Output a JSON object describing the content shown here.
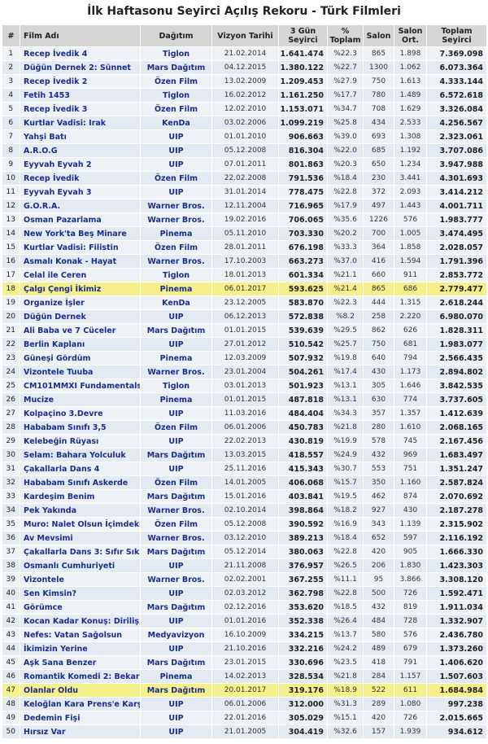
{
  "title": "İlk Haftasonu Seyirci Açılış Rekoru - Türk Filmleri",
  "columns": {
    "rank": "#",
    "film": "Film Adı",
    "distributor": "Dağıtım",
    "release": "Vizyon Tarihi",
    "audience_l1": "3 Gün",
    "audience_l2": "Seyirci",
    "pct_l1": "%",
    "pct_l2": "Toplam",
    "salon": "Salon",
    "avg_l1": "Salon",
    "avg_l2": "Ort.",
    "total_l1": "Toplam",
    "total_l2": "Seyirci"
  },
  "highlight_color": "#f5ef8c",
  "rows": [
    {
      "rank": "1",
      "film": "Recep İvedik 4",
      "dist": "Tiglon",
      "date": "21.02.2014",
      "aud": "1.641.474",
      "pct": "%22.3",
      "salon": "865",
      "avg": "1.898",
      "total": "7.369.098"
    },
    {
      "rank": "2",
      "film": "Düğün Dernek 2: Sünnet",
      "dist": "Mars Dağıtım",
      "date": "04.12.2015",
      "aud": "1.380.122",
      "pct": "%22.7",
      "salon": "1300",
      "avg": "1.062",
      "total": "6.073.364"
    },
    {
      "rank": "3",
      "film": "Recep İvedik 2",
      "dist": "Özen Film",
      "date": "13.02.2009",
      "aud": "1.209.453",
      "pct": "%27.9",
      "salon": "750",
      "avg": "1.613",
      "total": "4.333.144"
    },
    {
      "rank": "4",
      "film": "Fetih 1453",
      "dist": "Tiglon",
      "date": "16.02.2012",
      "aud": "1.161.250",
      "pct": "%17.7",
      "salon": "780",
      "avg": "1.489",
      "total": "6.572.618"
    },
    {
      "rank": "5",
      "film": "Recep İvedik 3",
      "dist": "Özen Film",
      "date": "12.02.2010",
      "aud": "1.153.071",
      "pct": "%34.7",
      "salon": "708",
      "avg": "1.629",
      "total": "3.326.084"
    },
    {
      "rank": "6",
      "film": "Kurtlar Vadisi: Irak",
      "dist": "KenDa",
      "date": "03.02.2006",
      "aud": "1.099.219",
      "pct": "%25.8",
      "salon": "434",
      "avg": "2.533",
      "total": "4.256.567"
    },
    {
      "rank": "7",
      "film": "Yahşi Batı",
      "dist": "UIP",
      "date": "01.01.2010",
      "aud": "906.663",
      "pct": "%39.0",
      "salon": "693",
      "avg": "1.308",
      "total": "2.323.061"
    },
    {
      "rank": "8",
      "film": "A.R.O.G",
      "dist": "UIP",
      "date": "05.12.2008",
      "aud": "816.304",
      "pct": "%22.0",
      "salon": "685",
      "avg": "1.192",
      "total": "3.707.086"
    },
    {
      "rank": "9",
      "film": "Eyyvah Eyvah 2",
      "dist": "UIP",
      "date": "07.01.2011",
      "aud": "801.863",
      "pct": "%20.3",
      "salon": "650",
      "avg": "1.234",
      "total": "3.947.988"
    },
    {
      "rank": "10",
      "film": "Recep İvedik",
      "dist": "Özen Film",
      "date": "22.02.2008",
      "aud": "791.536",
      "pct": "%18.4",
      "salon": "230",
      "avg": "3.441",
      "total": "4.301.693"
    },
    {
      "rank": "11",
      "film": "Eyyvah Eyvah 3",
      "dist": "UIP",
      "date": "31.01.2014",
      "aud": "778.475",
      "pct": "%22.8",
      "salon": "372",
      "avg": "2.093",
      "total": "3.414.212"
    },
    {
      "rank": "12",
      "film": "G.O.R.A.",
      "dist": "Warner Bros.",
      "date": "12.11.2004",
      "aud": "716.965",
      "pct": "%17.9",
      "salon": "497",
      "avg": "1.443",
      "total": "4.001.711"
    },
    {
      "rank": "13",
      "film": "Osman Pazarlama",
      "dist": "Warner Bros.",
      "date": "19.02.2016",
      "aud": "706.065",
      "pct": "%35.6",
      "salon": "1226",
      "avg": "576",
      "total": "1.983.777"
    },
    {
      "rank": "14",
      "film": "New York'ta Beş Minare",
      "dist": "Pinema",
      "date": "05.11.2010",
      "aud": "703.330",
      "pct": "%20.2",
      "salon": "700",
      "avg": "1.005",
      "total": "3.474.495"
    },
    {
      "rank": "15",
      "film": "Kurtlar Vadisi: Filistin",
      "dist": "Özen Film",
      "date": "28.01.2011",
      "aud": "676.198",
      "pct": "%33.3",
      "salon": "364",
      "avg": "1.858",
      "total": "2.028.057"
    },
    {
      "rank": "16",
      "film": "Asmalı Konak - Hayat",
      "dist": "Warner Bros.",
      "date": "17.10.2003",
      "aud": "663.273",
      "pct": "%37.0",
      "salon": "416",
      "avg": "1.594",
      "total": "1.791.396"
    },
    {
      "rank": "17",
      "film": "Celal ile Ceren",
      "dist": "Tiglon",
      "date": "18.01.2013",
      "aud": "601.334",
      "pct": "%21.1",
      "salon": "660",
      "avg": "911",
      "total": "2.853.772"
    },
    {
      "rank": "18",
      "film": "Çalgı Çengi İkimiz",
      "dist": "Pinema",
      "date": "06.01.2017",
      "aud": "593.625",
      "pct": "%21.4",
      "salon": "865",
      "avg": "686",
      "total": "2.779.477",
      "hl": true
    },
    {
      "rank": "19",
      "film": "Organize İşler",
      "dist": "KenDa",
      "date": "23.12.2005",
      "aud": "583.870",
      "pct": "%22.3",
      "salon": "444",
      "avg": "1.315",
      "total": "2.618.244"
    },
    {
      "rank": "20",
      "film": "Düğün Dernek",
      "dist": "UIP",
      "date": "06.12.2013",
      "aud": "572.838",
      "pct": "%8.2",
      "salon": "258",
      "avg": "2.220",
      "total": "6.980.070"
    },
    {
      "rank": "21",
      "film": "Ali Baba ve 7 Cüceler",
      "dist": "Mars Dağıtım",
      "date": "01.01.2015",
      "aud": "539.639",
      "pct": "%29.5",
      "salon": "862",
      "avg": "626",
      "total": "1.828.311"
    },
    {
      "rank": "22",
      "film": "Berlin Kaplanı",
      "dist": "UIP",
      "date": "27.01.2012",
      "aud": "510.542",
      "pct": "%25.7",
      "salon": "750",
      "avg": "681",
      "total": "1.983.077"
    },
    {
      "rank": "23",
      "film": "Güneşi Gördüm",
      "dist": "Pinema",
      "date": "12.03.2009",
      "aud": "507.932",
      "pct": "%19.8",
      "salon": "640",
      "avg": "794",
      "total": "2.566.435"
    },
    {
      "rank": "24",
      "film": "Vizontele Tuuba",
      "dist": "Warner Bros.",
      "date": "23.01.2004",
      "aud": "504.261",
      "pct": "%17.4",
      "salon": "430",
      "avg": "1.173",
      "total": "2.894.802"
    },
    {
      "rank": "25",
      "film": "CM101MMXI Fundamentals",
      "dist": "Tiglon",
      "date": "03.01.2013",
      "aud": "501.923",
      "pct": "%13.1",
      "salon": "305",
      "avg": "1.646",
      "total": "3.842.535"
    },
    {
      "rank": "26",
      "film": "Mucize",
      "dist": "Pinema",
      "date": "01.01.2015",
      "aud": "487.818",
      "pct": "%13.1",
      "salon": "630",
      "avg": "774",
      "total": "3.737.605"
    },
    {
      "rank": "27",
      "film": "Kolpaçino 3.Devre",
      "dist": "UIP",
      "date": "11.03.2016",
      "aud": "484.404",
      "pct": "%34.3",
      "salon": "357",
      "avg": "1.357",
      "total": "1.412.639"
    },
    {
      "rank": "28",
      "film": "Hababam Sınıfı 3,5",
      "dist": "Özen Film",
      "date": "06.01.2006",
      "aud": "450.783",
      "pct": "%21.8",
      "salon": "280",
      "avg": "1.610",
      "total": "2.068.165"
    },
    {
      "rank": "29",
      "film": "Kelebeğin Rüyası",
      "dist": "UIP",
      "date": "22.02.2013",
      "aud": "430.819",
      "pct": "%19.9",
      "salon": "578",
      "avg": "745",
      "total": "2.167.456"
    },
    {
      "rank": "30",
      "film": "Selam: Bahara Yolculuk",
      "dist": "Mars Dağıtım",
      "date": "13.03.2015",
      "aud": "418.557",
      "pct": "%24.9",
      "salon": "432",
      "avg": "969",
      "total": "1.683.497"
    },
    {
      "rank": "31",
      "film": "Çakallarla Dans 4",
      "dist": "UIP",
      "date": "25.11.2016",
      "aud": "415.343",
      "pct": "%30.7",
      "salon": "553",
      "avg": "751",
      "total": "1.351.247"
    },
    {
      "rank": "32",
      "film": "Hababam Sınıfı Askerde",
      "dist": "Özen Film",
      "date": "14.01.2005",
      "aud": "406.068",
      "pct": "%15.7",
      "salon": "350",
      "avg": "1.160",
      "total": "2.587.824"
    },
    {
      "rank": "33",
      "film": "Kardeşim Benim",
      "dist": "Mars Dağıtım",
      "date": "15.01.2016",
      "aud": "403.841",
      "pct": "%19.5",
      "salon": "462",
      "avg": "874",
      "total": "2.070.692"
    },
    {
      "rank": "34",
      "film": "Pek Yakında",
      "dist": "Warner Bros.",
      "date": "02.10.2014",
      "aud": "398.864",
      "pct": "%18.2",
      "salon": "927",
      "avg": "430",
      "total": "2.187.278"
    },
    {
      "rank": "35",
      "film": "Muro: Nalet Olsun İçimdeki İnsan",
      "dist": "Özen Film",
      "date": "05.12.2008",
      "aud": "390.592",
      "pct": "%16.9",
      "salon": "343",
      "avg": "1.139",
      "total": "2.315.902"
    },
    {
      "rank": "36",
      "film": "Av Mevsimi",
      "dist": "Warner Bros.",
      "date": "03.12.2010",
      "aud": "389.213",
      "pct": "%18.4",
      "salon": "652",
      "avg": "597",
      "total": "2.116.192"
    },
    {
      "rank": "37",
      "film": "Çakallarla Dans 3: Sıfır Sıkıntı",
      "dist": "Mars Dağıtım",
      "date": "05.12.2014",
      "aud": "380.063",
      "pct": "%22.8",
      "salon": "420",
      "avg": "905",
      "total": "1.666.330"
    },
    {
      "rank": "38",
      "film": "Osmanlı Cumhuriyeti",
      "dist": "UIP",
      "date": "21.11.2008",
      "aud": "376.957",
      "pct": "%26.5",
      "salon": "206",
      "avg": "1.830",
      "total": "1.423.303"
    },
    {
      "rank": "39",
      "film": "Vizontele",
      "dist": "Warner Bros.",
      "date": "02.02.2001",
      "aud": "367.255",
      "pct": "%11.1",
      "salon": "95",
      "avg": "3.866",
      "total": "3.308.120"
    },
    {
      "rank": "40",
      "film": "Sen Kimsin?",
      "dist": "UIP",
      "date": "02.03.2012",
      "aud": "362.798",
      "pct": "%22.8",
      "salon": "500",
      "avg": "726",
      "total": "1.592.471"
    },
    {
      "rank": "41",
      "film": "Görümce",
      "dist": "Mars Dağıtım",
      "date": "02.12.2016",
      "aud": "353.620",
      "pct": "%18.5",
      "salon": "432",
      "avg": "819",
      "total": "1.911.034"
    },
    {
      "rank": "42",
      "film": "Kocan Kadar Konuş: Diriliş",
      "dist": "UIP",
      "date": "01.01.2016",
      "aud": "352.338",
      "pct": "%26.4",
      "salon": "484",
      "avg": "728",
      "total": "1.332.907"
    },
    {
      "rank": "43",
      "film": "Nefes: Vatan Sağolsun",
      "dist": "Medyavizyon",
      "date": "16.10.2009",
      "aud": "334.215",
      "pct": "%13.7",
      "salon": "580",
      "avg": "576",
      "total": "2.436.780"
    },
    {
      "rank": "44",
      "film": "İkimizin Yerine",
      "dist": "UIP",
      "date": "21.10.2016",
      "aud": "332.216",
      "pct": "%24.2",
      "salon": "489",
      "avg": "679",
      "total": "1.373.260"
    },
    {
      "rank": "45",
      "film": "Aşk Sana Benzer",
      "dist": "Mars Dağıtım",
      "date": "23.01.2015",
      "aud": "330.696",
      "pct": "%23.5",
      "salon": "418",
      "avg": "791",
      "total": "1.406.620"
    },
    {
      "rank": "46",
      "film": "Romantik Komedi 2: Bekarlığa Veda",
      "dist": "Pinema",
      "date": "14.02.2013",
      "aud": "328.534",
      "pct": "%21.8",
      "salon": "284",
      "avg": "1.157",
      "total": "1.507.603"
    },
    {
      "rank": "47",
      "film": "Olanlar Oldu",
      "dist": "Mars Dağıtım",
      "date": "20.01.2017",
      "aud": "319.176",
      "pct": "%18.9",
      "salon": "522",
      "avg": "611",
      "total": "1.684.984",
      "hl": true
    },
    {
      "rank": "48",
      "film": "Keloğlan Kara Prens'e Karşı",
      "dist": "UIP",
      "date": "06.01.2006",
      "aud": "312.000",
      "pct": "%31.3",
      "salon": "289",
      "avg": "1.080",
      "total": "997.238"
    },
    {
      "rank": "49",
      "film": "Dedemin Fişi",
      "dist": "UIP",
      "date": "22.01.2016",
      "aud": "305.029",
      "pct": "%15.1",
      "salon": "420",
      "avg": "726",
      "total": "2.015.665"
    },
    {
      "rank": "50",
      "film": "Hırsız Var",
      "dist": "UIP",
      "date": "21.01.2005",
      "aud": "304.419",
      "pct": "%32.6",
      "salon": "157",
      "avg": "1.939",
      "total": "934.612"
    }
  ]
}
